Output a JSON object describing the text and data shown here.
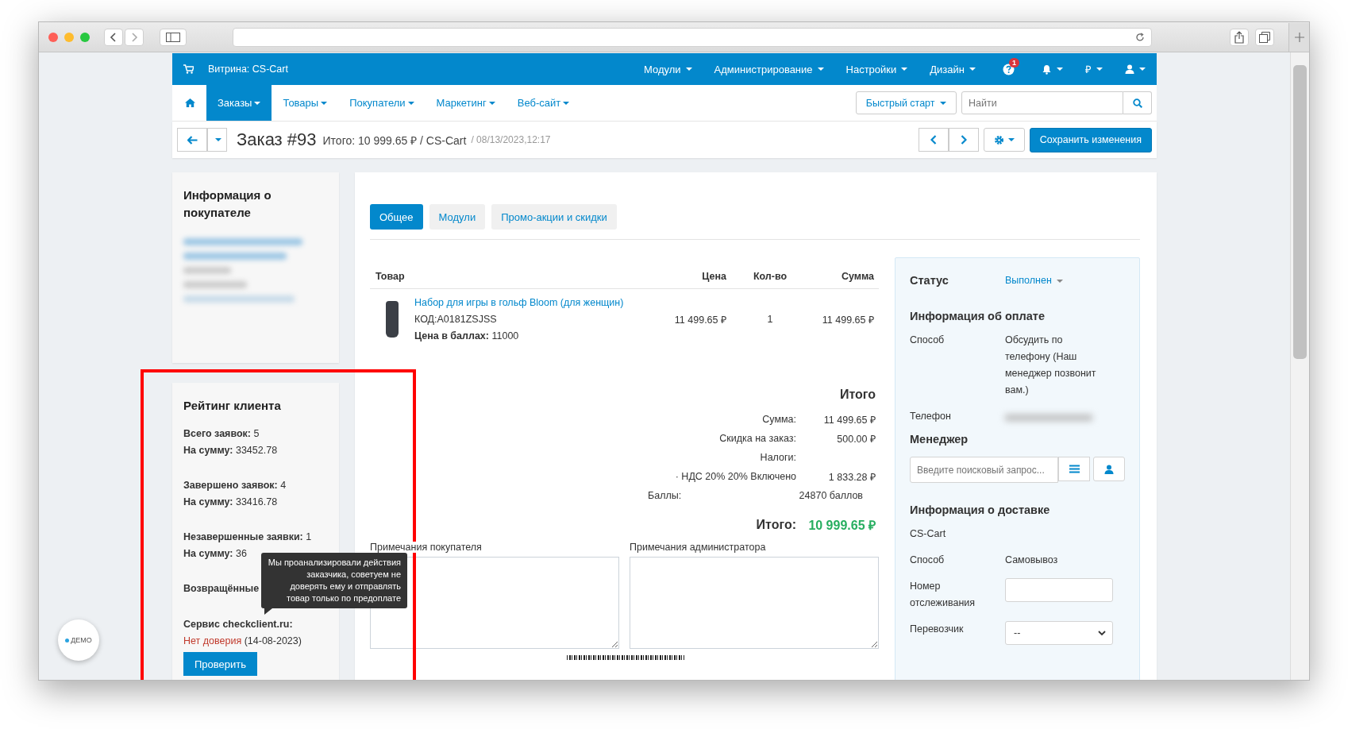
{
  "top_nav": {
    "store": "Витрина: CS-Cart",
    "menus": [
      "Модули",
      "Администрирование",
      "Настройки",
      "Дизайн"
    ],
    "help_badge": "1",
    "currency": "₽"
  },
  "main_nav": {
    "items": [
      {
        "label": "Заказы",
        "selected": true
      },
      {
        "label": "Товары",
        "selected": false
      },
      {
        "label": "Покупатели",
        "selected": false
      },
      {
        "label": "Маркетинг",
        "selected": false
      },
      {
        "label": "Веб-сайт",
        "selected": false
      }
    ],
    "quick_start": "Быстрый старт",
    "search": {
      "placeholder": "Найти"
    }
  },
  "header": {
    "title": "Заказ #93",
    "summary": "Итого: 10 999.65 ₽ / CS-Cart",
    "date": "/ 08/13/2023,12:17",
    "save_button": "Сохранить изменения"
  },
  "customer_card": {
    "title": "Информация о покупателе"
  },
  "rating_card": {
    "title": "Рейтинг клиента",
    "groups": [
      [
        {
          "label": "Всего заявок:",
          "value": "5"
        },
        {
          "label": "На сумму:",
          "value": "33452.78"
        }
      ],
      [
        {
          "label": "Завершено заявок:",
          "value": "4"
        },
        {
          "label": "На сумму:",
          "value": "33416.78"
        }
      ],
      [
        {
          "label": "Незавершенные заявки:",
          "value": "1"
        },
        {
          "label": "На сумму:",
          "value": "36"
        }
      ]
    ],
    "returned_label": "Возвращённые",
    "service_label": "Сервис checkclient.ru:",
    "trust": "Нет доверия",
    "trust_date": "(14-08-2023)",
    "check_button": "Проверить"
  },
  "tooltip": "Мы проанализировали действия заказчика, советуем не доверять ему и отправлять товар только по предоплате",
  "tabs": [
    {
      "label": "Общее",
      "selected": true
    },
    {
      "label": "Модули",
      "selected": false
    },
    {
      "label": "Промо-акции и скидки",
      "selected": false
    }
  ],
  "products": {
    "columns": [
      "Товар",
      "Цена",
      "Кол-во",
      "Сумма"
    ],
    "rows": [
      {
        "name": "Набор для игры в гольф Bloom (для женщин)",
        "code": "КОД:A0181ZSJSS",
        "points_label": "Цена в баллах:",
        "points": "11000",
        "price": "11 499.65 ₽",
        "qty": "1",
        "sum": "11 499.65 ₽"
      }
    ]
  },
  "totals": {
    "title": "Итого",
    "rows": [
      {
        "kind": "amount",
        "label": "Сумма:",
        "value": "11 499.65 ₽"
      },
      {
        "kind": "amount",
        "label": "Скидка на заказ:",
        "value": "500.00 ₽"
      },
      {
        "kind": "amount",
        "label": "Налоги:"
      },
      {
        "kind": "amount",
        "label": "· НДС 20% 20% Включено",
        "value": "1 833.28 ₽"
      },
      {
        "kind": "points",
        "label": "Баллы:",
        "value": "24870 баллов"
      }
    ],
    "grand_label": "Итого:",
    "grand_value": "10 999.65 ₽"
  },
  "notes": {
    "customer_label": "Примечания покупателя",
    "admin_label": "Примечания администратора"
  },
  "side_panel": {
    "status_label": "Статус",
    "status": "Выполнен",
    "payment_title": "Информация об оплате",
    "payment_method_label": "Способ",
    "payment_method": "Обсудить по телефону (Наш менеджер позвонит вам.)",
    "phone_label": "Телефон",
    "manager_title": "Менеджер",
    "manager_search": {
      "placeholder": "Введите поисковый запрос..."
    },
    "shipping_title": "Информация о доставке",
    "shipping_store": "CS-Cart",
    "shipping_method_label": "Способ",
    "shipping_method": "Самовывоз",
    "tracking_label": "Номер отслеживания",
    "carrier_label": "Перевозчик",
    "carrier_value": "--"
  },
  "demo_badge": "ДЕМО"
}
